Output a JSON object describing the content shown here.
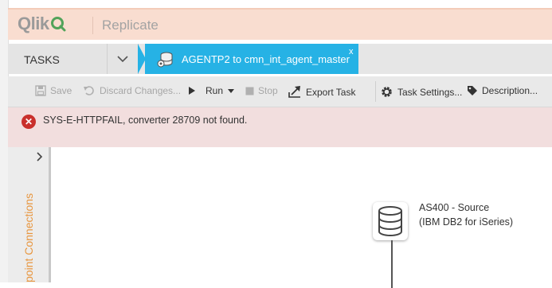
{
  "header": {
    "logo_text": "Qlik",
    "app_name": "Replicate"
  },
  "tabs": {
    "tasks_label": "TASKS",
    "active_task_label": "AGENTP2 to cmn_int_agent_master",
    "close_glyph": "x"
  },
  "toolbar": {
    "save_label": "Save",
    "discard_label": "Discard Changes...",
    "run_label": "Run",
    "stop_label": "Stop",
    "export_label": "Export Task",
    "task_settings_label": "Task Settings...",
    "description_label": "Description..."
  },
  "error": {
    "message": "SYS-E-HTTPFAIL, converter 28709 not found."
  },
  "left_panel": {
    "vertical_label": "point Connections"
  },
  "source_node": {
    "name": "AS400 - Source",
    "type": "(IBM DB2 for iSeries)"
  },
  "colors": {
    "header_bg": "#f9ddd0",
    "active_tab": "#26b2e5",
    "error_bg": "#f2dede",
    "error_icon": "#c9302c",
    "panel_label": "#e8963f"
  }
}
